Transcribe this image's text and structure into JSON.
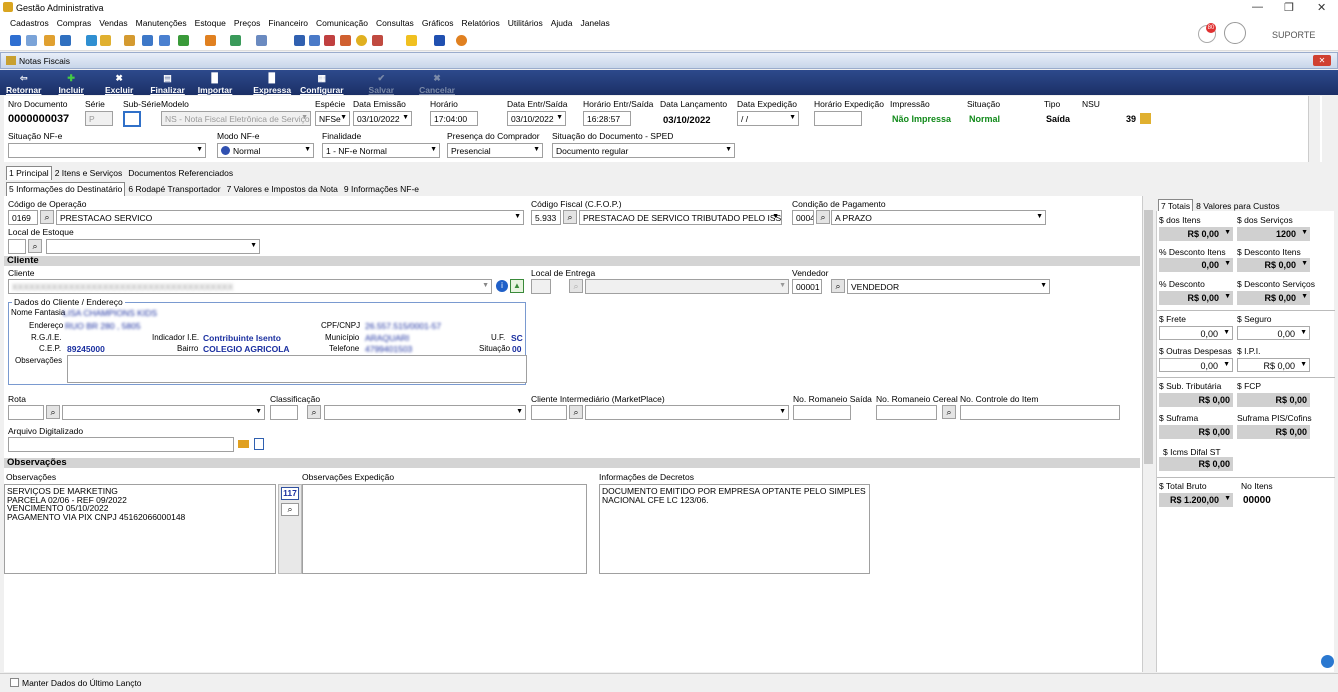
{
  "app_title": "Gestão Administrativa",
  "menu": [
    "Cadastros",
    "Compras",
    "Vendas",
    "Manutenções",
    "Estoque",
    "Preços",
    "Financeiro",
    "Comunicação",
    "Consultas",
    "Gráficos",
    "Relatórios",
    "Utilitários",
    "Ajuda",
    "Janelas"
  ],
  "user_label": "SUPORTE",
  "notif_count": "80",
  "window_title": "Notas Fiscais",
  "toolbar": {
    "retornar": "Retornar",
    "incluir": "Incluir",
    "excluir": "Excluir",
    "finalizar": "Finalizar",
    "importar": "Importar",
    "expressa": "Expressa",
    "configurar": "Configurar",
    "salvar": "Salvar",
    "cancelar": "Cancelar"
  },
  "hdr": {
    "nro_label": "Nro Documento",
    "nro": "0000000037",
    "serie_label": "Série",
    "serie": "P",
    "subserie_label": "Sub-Série",
    "modelo_label": "Modelo",
    "modelo": "NS - Nota Fiscal Eletrônica de Serviço",
    "especie_label": "Espécie",
    "especie": "NFSe",
    "emissao_label": "Data Emissão",
    "emissao": "03/10/2022",
    "horario_label": "Horário",
    "horario": "17:04:00",
    "entr_label": "Data Entr/Saída",
    "entr": "03/10/2022",
    "hora_entr_label": "Horário Entr/Saída",
    "hora_entr": "16:28:57",
    "lanc_label": "Data Lançamento",
    "lanc": "03/10/2022",
    "exped_label": "Data Expedição",
    "exped": " / /",
    "hora_exped_label": "Horário Expedição",
    "impressao_label": "Impressão",
    "impressao": "Não Impressa",
    "situacao_label": "Situação",
    "situacao": "Normal",
    "tipo_label": "Tipo",
    "tipo": "Saída",
    "nsu_label": "NSU",
    "nsu": "39",
    "sit_nfe_label": "Situação NF-e",
    "modo_label": "Modo NF-e",
    "modo": "Normal",
    "finalidade_label": "Finalidade",
    "finalidade": "1 - NF-e Normal",
    "presenca_label": "Presença do Comprador",
    "presenca": "Presencial",
    "sped_label": "Situação do Documento - SPED",
    "sped": "Documento regular"
  },
  "tabs1": [
    "1 Principal",
    "2 Itens e Serviços",
    "Documentos Referenciados"
  ],
  "tabs2": [
    "5 Informações do Destinatário",
    "6 Rodapé Transportador",
    "7 Valores e Impostos da Nota",
    "9 Informações NF-e"
  ],
  "main": {
    "cod_op_label": "Código de Operação",
    "cod_op": "0169",
    "cod_op_desc": "PRESTACAO SERVICO",
    "cfop_label": "Código Fiscal (C.F.O.P.)",
    "cfop": "5.933",
    "cfop_desc": "PRESTACAO DE SERVICO TRIBUTADO PELO ISS",
    "cond_label": "Condição de Pagamento",
    "cond": "0004",
    "cond_desc": "A PRAZO",
    "local_estoque_label": "Local de Estoque",
    "cliente_section": "Cliente",
    "cliente_label": "Cliente",
    "cliente": "XXXXXXXXXXXXXXXXXXXXXXXXXXXXXXXXXXXXXXX",
    "local_entrega_label": "Local de Entrega",
    "vendedor_label": "Vendedor",
    "vendedor": "00001",
    "vendedor_desc": "VENDEDOR",
    "dados_label": "Dados do Cliente / Endereço",
    "fantasia_label": "Nome Fantasia",
    "fantasia": "LISA CHAMPIONS KIDS",
    "endereco_label": "Endereço",
    "endereco": "RUO BR 280 , 5805",
    "cpf_label": "CPF/CNPJ",
    "cpf": "26.557.515/0001-57",
    "rg_label": "R.G./I.E.",
    "ind_ie_label": "Indicador I.E.",
    "ind_ie": "Contribuinte Isento",
    "municipio_label": "Município",
    "municipio": "ARAQUARI",
    "uf_label": "U.F.",
    "uf": "SC",
    "cep_label": "C.E.P.",
    "cep": "89245000",
    "bairro_label": "Bairro",
    "bairro": "COLEGIO AGRICOLA",
    "telefone_label": "Telefone",
    "telefone": "4799401503",
    "situacao2_label": "Situação",
    "situacao2": "00",
    "obs_cli_label": "Observações",
    "rota_label": "Rota",
    "classif_label": "Classificação",
    "intermed_label": "Cliente Intermediário (MarketPlace)",
    "romaneio_label": "No. Romaneio Saída",
    "romaneio_cereal_label": "No. Romaneio Cereal",
    "controle_label": "No. Controle do Item",
    "arquivo_label": "Arquivo Digitalizado",
    "obs_section": "Observações",
    "obs_label": "Observações",
    "obs_text": "SERVIÇOS DE MARKETING\nPARCELA 02/06 - REF 09/2022\nVENCIMENTO 05/10/2022\nPAGAMENTO VIA PIX CNPJ 45162066000148",
    "obs_count": "117",
    "obs_exp_label": "Observações Expedição",
    "decretos_label": "Informações de Decretos",
    "decretos_text": "DOCUMENTO EMITIDO POR EMPRESA OPTANTE PELO SIMPLES\nNACIONAL CFE LC 123/06."
  },
  "totals_tabs": [
    "7 Totais",
    "8 Valores para Custos"
  ],
  "totals": {
    "itens_label": "$ dos Itens",
    "itens": "R$ 0,00",
    "servicos_label": "$ dos Serviços",
    "servicos": "1200",
    "desc_itens_label": "% Desconto Itens",
    "desc_itens": "0,00",
    "desc_itens_val_label": "$ Desconto Itens",
    "desc_itens_val": "R$ 0,00",
    "desc_serv_label": "% Desconto Serviços",
    "desc_serv": "R$ 0,00",
    "desc_serv_val_label": "$ Desconto Serviços",
    "desc_serv_val": "R$ 0,00",
    "frete_label": "$ Frete",
    "frete": "0,00",
    "seguro_label": "$ Seguro",
    "seguro": "0,00",
    "outras_label": "$ Outras Despesas",
    "outras": "0,00",
    "ipi_label": "$ I.P.I.",
    "ipi": "R$ 0,00",
    "subtrib_label": "$ Sub. Tributária",
    "subtrib": "R$ 0,00",
    "fcp_label": "$ FCP",
    "fcp": "R$ 0,00",
    "suframa_label": "$ Suframa",
    "suframa": "R$ 0,00",
    "suframa_pis_label": "Suframa PIS/Cofins",
    "suframa_pis": "R$ 0,00",
    "icms_label": "$ Icms Difal ST",
    "icms": "R$ 0,00",
    "bruto_label": "$ Total Bruto",
    "bruto": "R$ 1.200,00",
    "no_itens_label": "No Itens",
    "no_itens": "00000"
  },
  "footer_check": "Manter Dados do Último Lançto"
}
